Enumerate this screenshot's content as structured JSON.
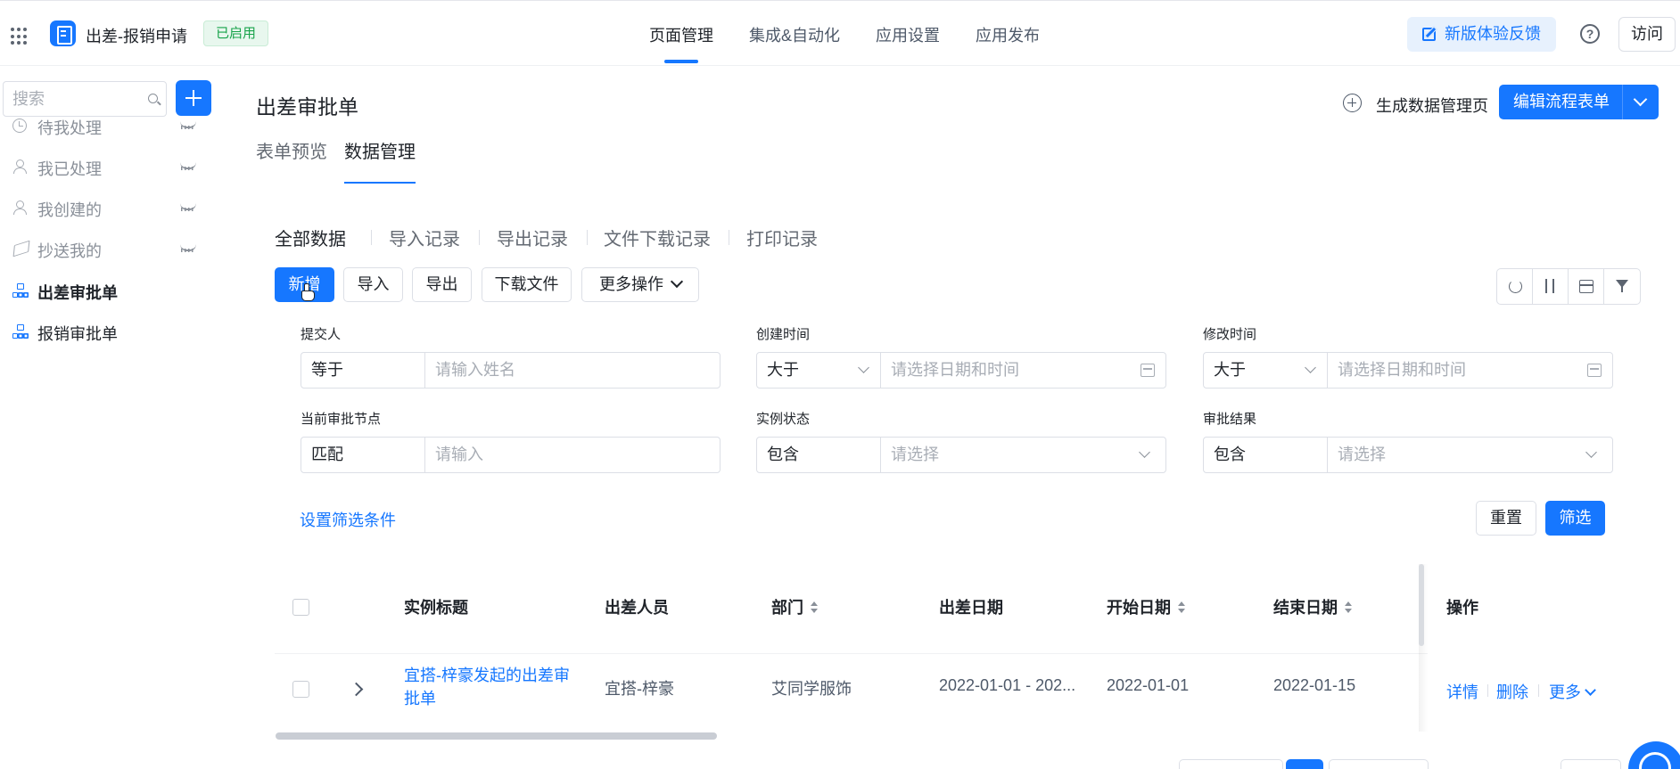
{
  "header": {
    "app_title": "出差-报销申请",
    "status_badge": "已启用",
    "nav": [
      "页面管理",
      "集成&自动化",
      "应用设置",
      "应用发布"
    ],
    "active_nav": "页面管理",
    "feedback_label": "新版体验反馈",
    "help_label": "?",
    "visit_label": "访问"
  },
  "sidebar": {
    "search_placeholder": "搜索",
    "items": [
      {
        "label": "待我处理",
        "icon": "clock-icon"
      },
      {
        "label": "我已处理",
        "icon": "person-check-icon"
      },
      {
        "label": "我创建的",
        "icon": "person-add-icon"
      },
      {
        "label": "抄送我的",
        "icon": "send-icon"
      },
      {
        "label": "出差审批单",
        "icon": "flow-icon",
        "active": true
      },
      {
        "label": "报销审批单",
        "icon": "flow-icon"
      }
    ]
  },
  "page": {
    "title": "出差审批单",
    "generate_label": "生成数据管理页",
    "edit_flow_label": "编辑流程表单",
    "subtabs": [
      "表单预览",
      "数据管理"
    ],
    "active_subtab": "数据管理"
  },
  "data_tabs": [
    "全部数据",
    "导入记录",
    "导出记录",
    "文件下载记录",
    "打印记录"
  ],
  "actions": {
    "add": "新增",
    "import": "导入",
    "export": "导出",
    "download": "下载文件",
    "more": "更多操作"
  },
  "filters": [
    {
      "label": "提交人",
      "operator": "等于",
      "placeholder": "请输入姓名"
    },
    {
      "label": "创建时间",
      "operator": "大于",
      "placeholder": "请选择日期和时间"
    },
    {
      "label": "修改时间",
      "operator": "大于",
      "placeholder": "请选择日期和时间"
    },
    {
      "label": "当前审批节点",
      "operator": "匹配",
      "placeholder": "请输入"
    },
    {
      "label": "实例状态",
      "operator": "包含",
      "placeholder": "请选择"
    },
    {
      "label": "审批结果",
      "operator": "包含",
      "placeholder": "请选择"
    }
  ],
  "filter_actions": {
    "set_conditions": "设置筛选条件",
    "reset": "重置",
    "apply": "筛选"
  },
  "table": {
    "columns": [
      "实例标题",
      "出差人员",
      "部门",
      "出差日期",
      "开始日期",
      "结束日期",
      "操作"
    ],
    "rows": [
      {
        "title": "宜搭-梓豪发起的出差审批单",
        "traveler": "宜搭-梓豪",
        "department": "艾同学服饰",
        "trip_dates": "2022-01-01 - 202...",
        "start_date": "2022-01-01",
        "end_date": "2022-01-15",
        "ops": [
          "详情",
          "删除",
          "更多"
        ]
      }
    ]
  },
  "colors": {
    "accent": "#1677ff",
    "badge_green": "#17a34a"
  }
}
